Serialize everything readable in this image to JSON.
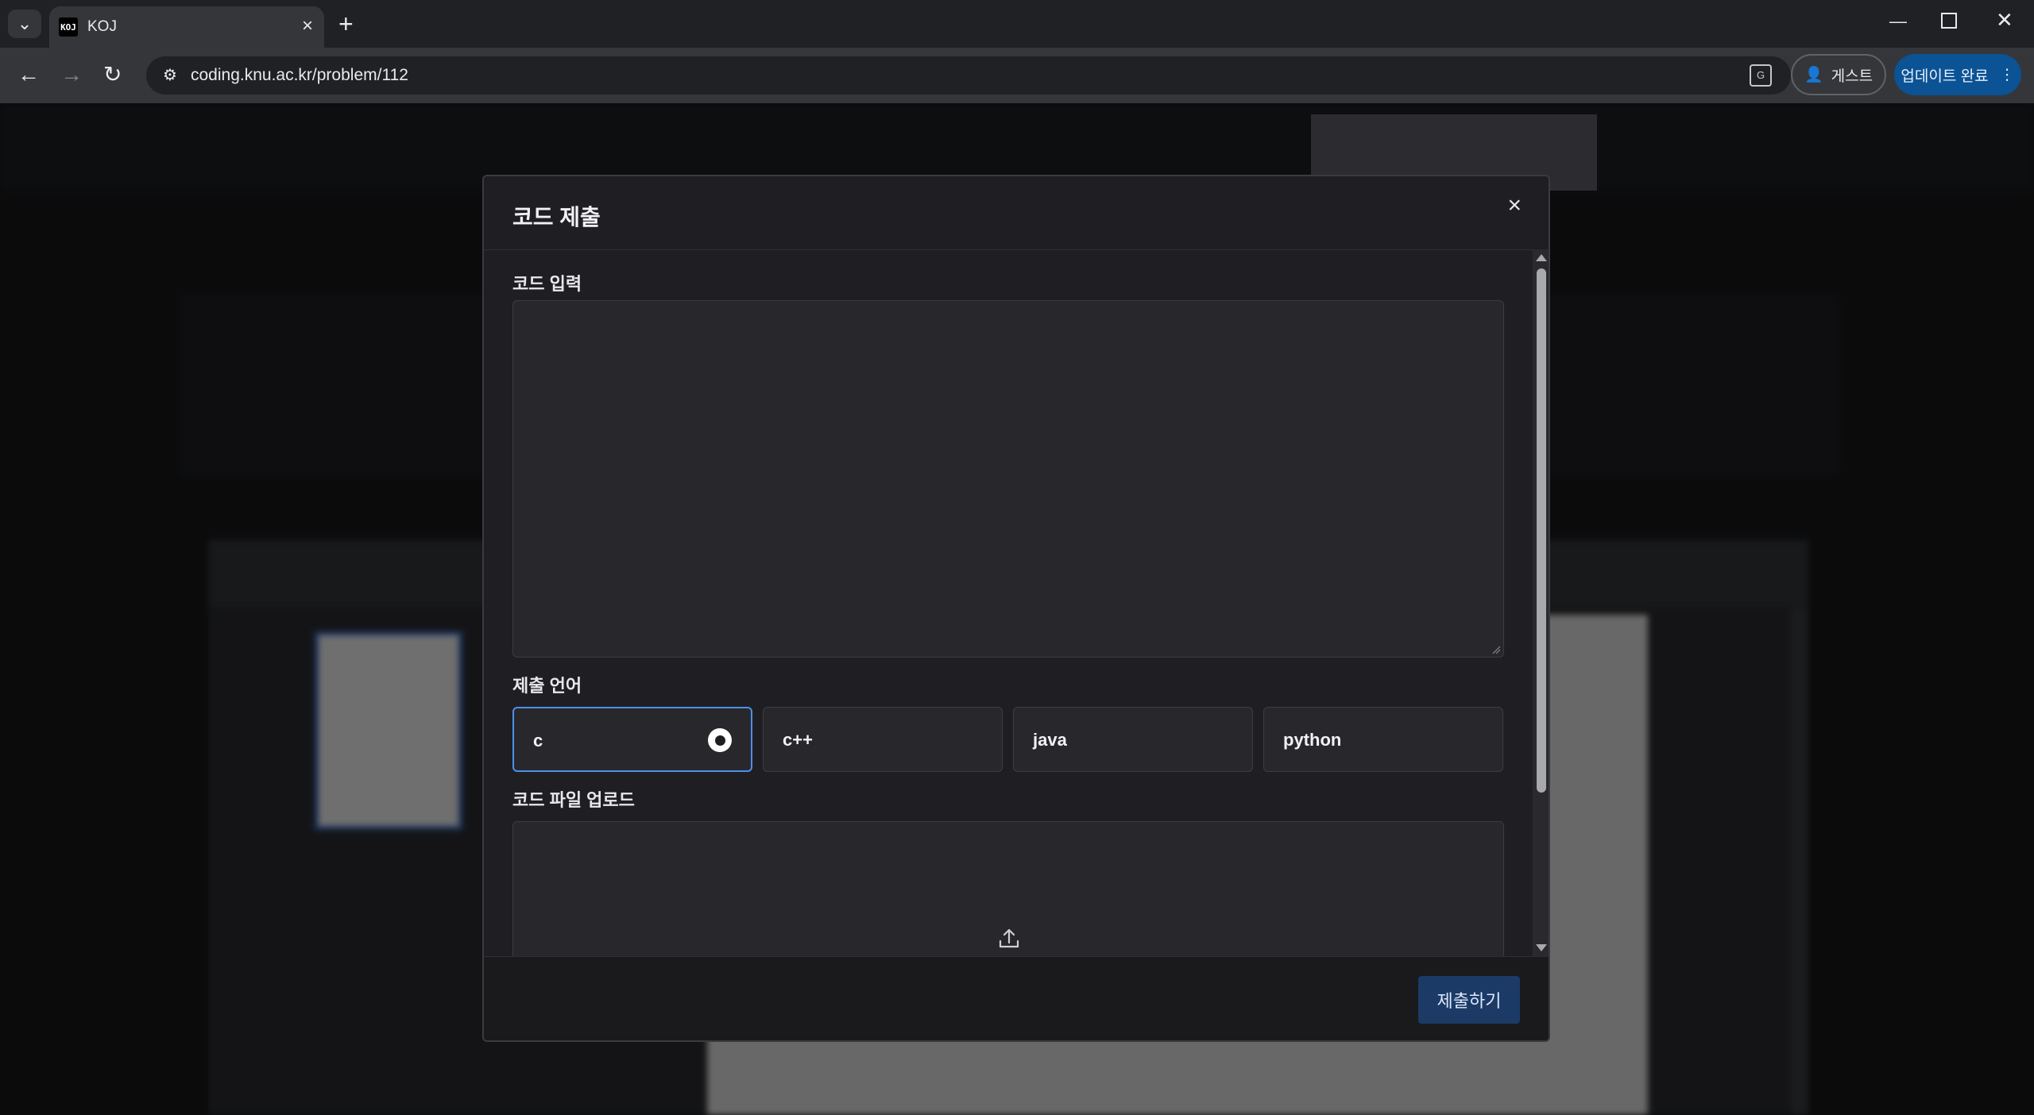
{
  "browser": {
    "tab_title": "KOJ",
    "favicon_text": "KOJ",
    "url": "coding.knu.ac.kr/problem/112",
    "guest_label": "게스트",
    "update_label": "업데이트 완료"
  },
  "modal": {
    "title": "코드 제출",
    "code_label": "코드 입력",
    "code_value": "",
    "language_label": "제출 언어",
    "languages": [
      {
        "label": "c",
        "selected": true
      },
      {
        "label": "c++",
        "selected": false
      },
      {
        "label": "java",
        "selected": false
      },
      {
        "label": "python",
        "selected": false
      }
    ],
    "upload_label": "코드 파일 업로드",
    "submit_label": "제출하기"
  },
  "colors": {
    "accent": "#4f8fe8",
    "submit_bg": "#1b3a66",
    "modal_bg": "#1f1f23"
  }
}
